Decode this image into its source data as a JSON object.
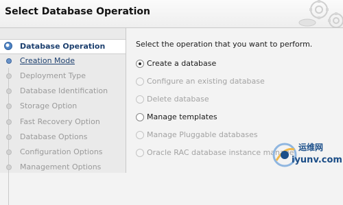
{
  "window": {
    "title": "Select Database Operation"
  },
  "sidebar": {
    "steps": [
      {
        "label": "Database Operation",
        "state": "active"
      },
      {
        "label": "Creation Mode",
        "state": "link"
      },
      {
        "label": "Deployment Type",
        "state": "pending"
      },
      {
        "label": "Database Identification",
        "state": "pending"
      },
      {
        "label": "Storage Option",
        "state": "pending"
      },
      {
        "label": "Fast Recovery Option",
        "state": "pending"
      },
      {
        "label": "Database Options",
        "state": "pending"
      },
      {
        "label": "Configuration Options",
        "state": "pending"
      },
      {
        "label": "Management Options",
        "state": "pending"
      }
    ]
  },
  "main": {
    "instruction": "Select the operation that you want to perform.",
    "options": [
      {
        "label": "Create a database",
        "selected": true,
        "enabled": true
      },
      {
        "label": "Configure an existing database",
        "selected": false,
        "enabled": false
      },
      {
        "label": "Delete database",
        "selected": false,
        "enabled": false
      },
      {
        "label": "Manage templates",
        "selected": false,
        "enabled": true
      },
      {
        "label": "Manage Pluggable databases",
        "selected": false,
        "enabled": false
      },
      {
        "label": "Oracle RAC database instance manage",
        "selected": false,
        "enabled": false
      }
    ]
  },
  "watermark": {
    "name": "运维网",
    "url": "iyunv.com"
  },
  "colors": {
    "accent": "#1c3f6e",
    "disabled_text": "#a3a3a3",
    "sidebar_bg": "#eaeaea"
  }
}
